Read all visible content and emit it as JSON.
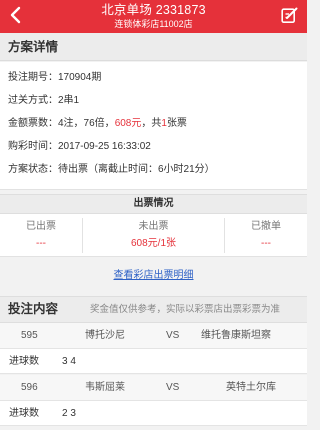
{
  "header": {
    "title": "北京单场 2331873",
    "subtitle": "连锁体彩店11002店",
    "colors": {
      "accent": "#e5313a"
    },
    "icons": {
      "back": "chevron-left-icon",
      "edit": "edit-icon"
    }
  },
  "details": {
    "heading": "方案详情",
    "issue": "投注期号：170904期",
    "pass_mode": "过关方式：2串1",
    "amount_prefix": "金额票数：4注，76倍，",
    "amount_value": "608元",
    "amount_mid": "，共",
    "ticket_count": "1",
    "amount_suffix": "张票",
    "purchase_time": "购彩时间：2017-09-25 16:33:02",
    "status": "方案状态：待出票（离截止时间：6小时21分）"
  },
  "ticketing": {
    "heading": "出票情况",
    "cells": [
      {
        "label": "已出票",
        "value": "---"
      },
      {
        "label": "未出票",
        "value": "608元/1张"
      },
      {
        "label": "已撤单",
        "value": "---"
      }
    ],
    "link": "查看彩店出票明细"
  },
  "bets": {
    "heading": "投注内容",
    "note": "奖金值仅供参考，实际以彩票店出票彩票为准",
    "goals_label": "进球数",
    "matches": [
      {
        "number": "595",
        "home": "博托沙尼",
        "vs": "VS",
        "away": "维托鲁康斯坦察",
        "goals": "3 4"
      },
      {
        "number": "596",
        "home": "韦斯屈莱",
        "vs": "VS",
        "away": "英特土尔库",
        "goals": "2 3"
      }
    ]
  }
}
